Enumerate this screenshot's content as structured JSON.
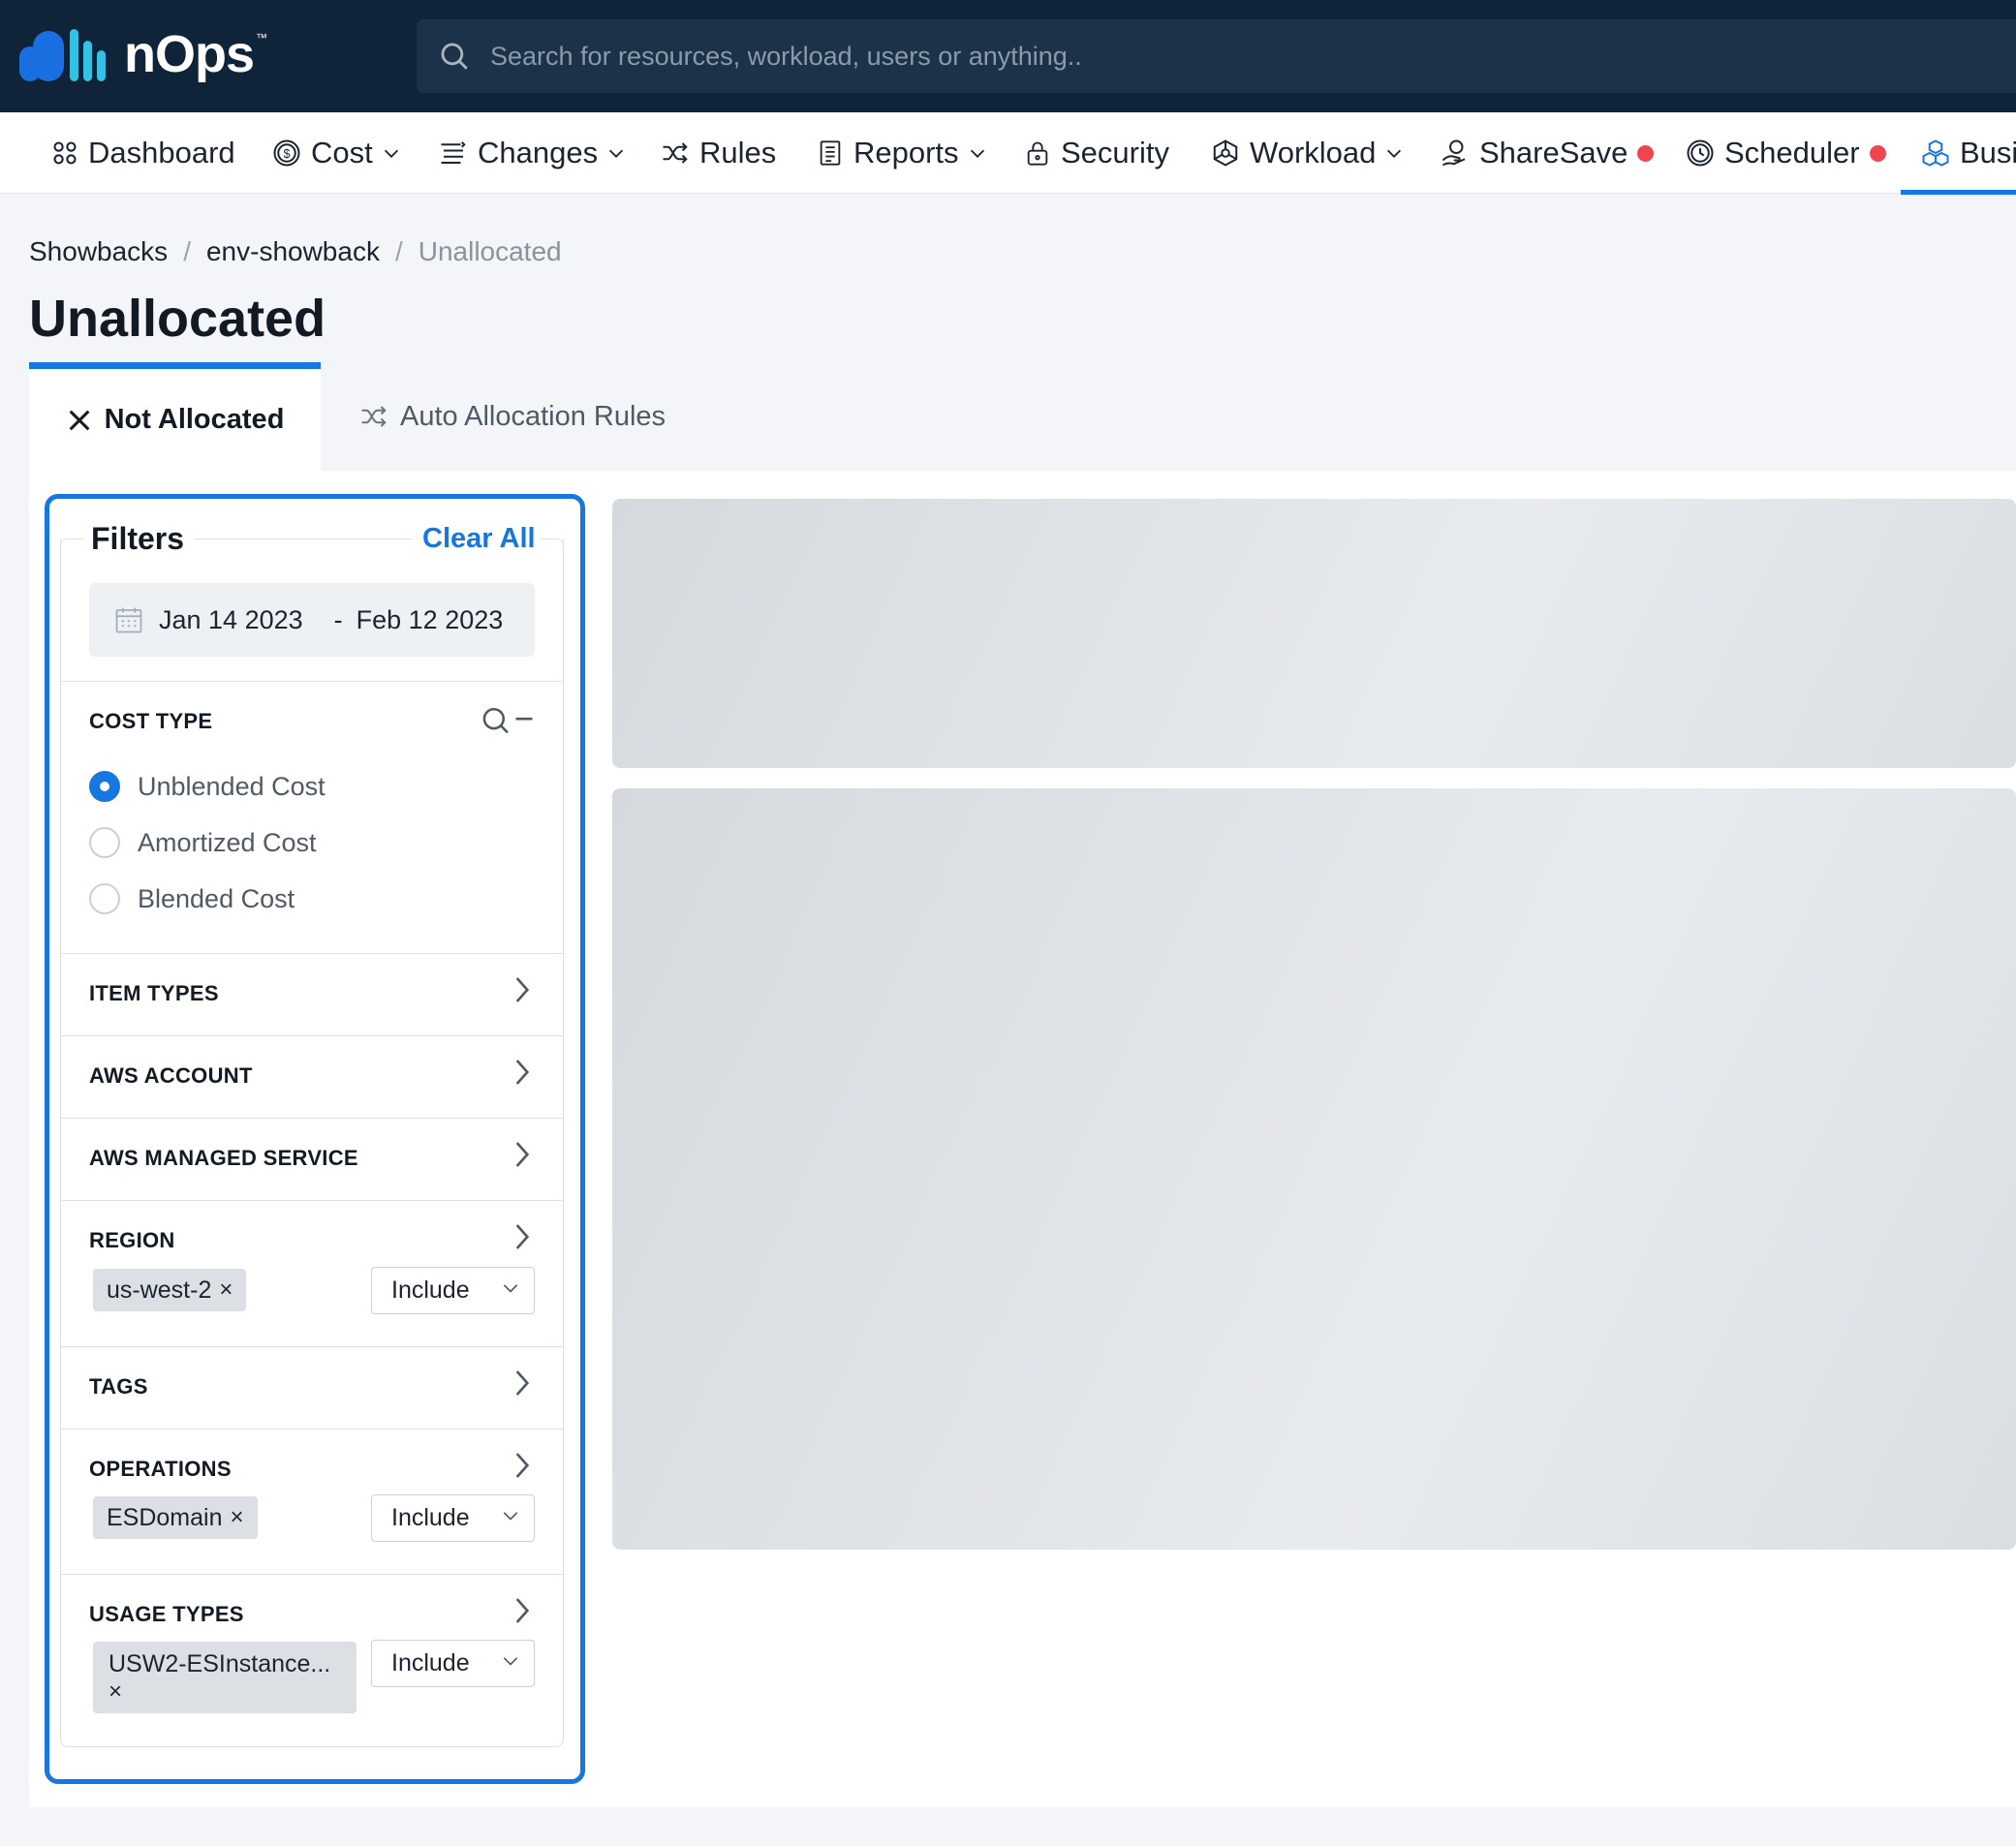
{
  "brand": {
    "name": "nOps",
    "tm": "™",
    "accent": "#1677e0",
    "logo_blue": "#1a6fe0",
    "logo_cyan": "#33c1e6"
  },
  "search": {
    "placeholder": "Search for resources, workload, users or anything..",
    "icon": "search-icon"
  },
  "nav": {
    "items": [
      {
        "label": "Dashboard",
        "icon": "grid-icon"
      },
      {
        "label": "Cost",
        "icon": "dollar-circle-icon",
        "dropdown": true
      },
      {
        "label": "Changes",
        "icon": "list-icon",
        "dropdown": true
      },
      {
        "label": "Rules",
        "icon": "shuffle-icon"
      },
      {
        "label": "Reports",
        "icon": "document-icon",
        "dropdown": true
      },
      {
        "label": "Security",
        "icon": "lock-icon"
      },
      {
        "label": "Workload",
        "icon": "hexagon-icon",
        "dropdown": true
      },
      {
        "label": "ShareSave",
        "icon": "hand-coin-icon",
        "badge_color": "#f0454f"
      },
      {
        "label": "Scheduler",
        "icon": "clock-icon",
        "badge_color": "#f0454f"
      },
      {
        "label": "Busi",
        "icon": "cubes-icon",
        "active": true
      }
    ]
  },
  "breadcrumb": {
    "items": [
      "Showbacks",
      "env-showback"
    ],
    "separator": "/",
    "current": "Unallocated"
  },
  "page": {
    "title": "Unallocated"
  },
  "tabs": [
    {
      "label": "Not Allocated",
      "icon": "close-icon",
      "active": true
    },
    {
      "label": "Auto Allocation Rules",
      "icon": "shuffle-icon",
      "active": false
    }
  ],
  "filters": {
    "title": "Filters",
    "clear_all": "Clear All",
    "date_start": "Jan 14 2023",
    "date_sep": "-",
    "date_end": "Feb 12 2023",
    "cost_type": {
      "label": "COST TYPE",
      "options": [
        "Unblended Cost",
        "Amortized Cost",
        "Blended Cost"
      ],
      "selected": "Unblended Cost"
    },
    "sections": {
      "item_types": "ITEM TYPES",
      "aws_account": "AWS ACCOUNT",
      "aws_managed_service": "AWS MANAGED SERVICE",
      "region": "REGION",
      "tags": "TAGS",
      "operations": "OPERATIONS",
      "usage_types": "USAGE TYPES"
    },
    "region_chip": "us-west-2",
    "operations_chip": "ESDomain",
    "usage_types_chip": "USW2-ESInstance...",
    "chip_remove": "×",
    "include_label": "Include"
  }
}
